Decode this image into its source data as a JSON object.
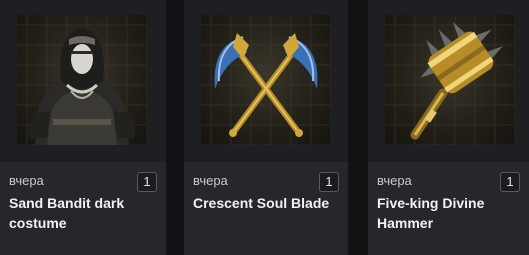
{
  "items": [
    {
      "date": "вчера",
      "count": "1",
      "name": "Sand Bandit dark costume",
      "icon": "bandit-costume-icon"
    },
    {
      "date": "вчера",
      "count": "1",
      "name": "Crescent Soul Blade",
      "icon": "crescent-blades-icon"
    },
    {
      "date": "вчера",
      "count": "1",
      "name": "Five-king Divine Hammer",
      "icon": "hammer-icon"
    }
  ],
  "colors": {
    "card_bg": "#26272b",
    "page_bg": "#111214",
    "gold": "#c9a13a",
    "steel_blue": "#3b6fb6"
  }
}
